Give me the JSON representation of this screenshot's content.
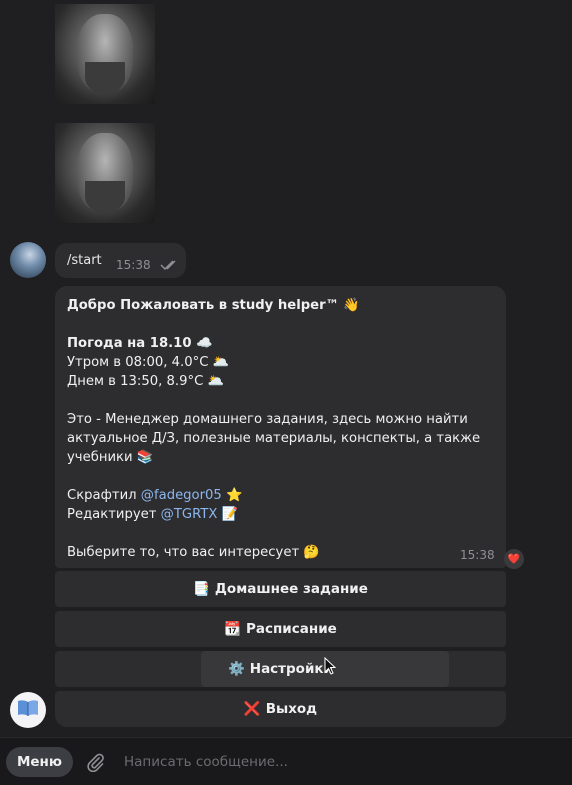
{
  "chat": {
    "start_message": {
      "text": "/start",
      "time": "15:38"
    },
    "bot_message": {
      "lines": [
        {
          "text": "Добро Пожаловать в study helper™ 👋",
          "bold": true
        },
        {
          "text": ""
        },
        {
          "text": "Погода на 18.10 ☁️",
          "bold": true
        },
        {
          "text": "Утром в 08:00, 4.0°C 🌥️"
        },
        {
          "text": "Днем в 13:50, 8.9°C 🌥️"
        },
        {
          "text": ""
        },
        {
          "text": "Это - Менеджер домашнего задания, здесь можно найти"
        },
        {
          "text": "актуальное Д/З, полезные материалы, конспекты, а также"
        },
        {
          "text": "учебники 📚"
        },
        {
          "text": ""
        },
        {
          "text_prefix": "Скрафтил ",
          "link": "@fadegor05",
          "suffix": " ⭐"
        },
        {
          "text_prefix": "Редактирует ",
          "link": "@TGRTX",
          "suffix": " 📝"
        },
        {
          "text": ""
        },
        {
          "text": "Выберите то, что вас интересует 🤔"
        }
      ],
      "time": "15:38",
      "reaction": "❤️"
    },
    "keyboard": [
      {
        "emoji": "📑",
        "label": "Домашнее задание"
      },
      {
        "emoji": "📆",
        "label": "Расписание"
      },
      {
        "emoji": "⚙️",
        "label": "Настройки"
      },
      {
        "emoji": "❌",
        "label": "Выход"
      }
    ]
  },
  "composer": {
    "menu_label": "Меню",
    "placeholder": "Написать сообщение..."
  },
  "colors": {
    "background": "#1f1f21",
    "bubble": "#2d2d30",
    "link": "#8cb6ec",
    "timestamp": "#8f8f94"
  },
  "icons": [
    "attach-icon",
    "double-check-icon",
    "heart-reaction-icon",
    "cursor-icon",
    "book-icon"
  ]
}
